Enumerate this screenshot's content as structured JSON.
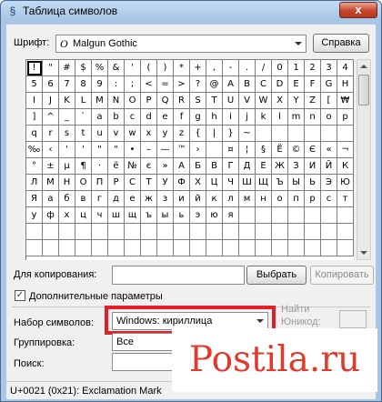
{
  "window": {
    "title": "Таблица символов",
    "close": "x"
  },
  "font": {
    "label": "Шрифт:",
    "icon": "O",
    "value": "Malgun Gothic",
    "help_button": "Справка"
  },
  "grid": {
    "rows": [
      [
        "!",
        "\"",
        "#",
        "$",
        "%",
        "&",
        "'",
        "(",
        ")",
        "*",
        "+",
        ",",
        "-",
        ".",
        "/",
        "0",
        "1",
        "2",
        "3",
        "4"
      ],
      [
        "5",
        "6",
        "7",
        "8",
        "9",
        ":",
        ";",
        "<",
        "=",
        ">",
        "?",
        "@",
        "A",
        "B",
        "C",
        "D",
        "E",
        "F",
        "G",
        "H"
      ],
      [
        "I",
        "J",
        "K",
        "L",
        "M",
        "N",
        "O",
        "P",
        "Q",
        "R",
        "S",
        "T",
        "U",
        "V",
        "W",
        "X",
        "Y",
        "Z",
        "[",
        "₩"
      ],
      [
        "]",
        "^",
        "_",
        "`",
        "a",
        "b",
        "c",
        "d",
        "e",
        "f",
        "g",
        "h",
        "i",
        "j",
        "k",
        "l",
        "m",
        "n",
        "o",
        "p"
      ],
      [
        "q",
        "r",
        "s",
        "t",
        "u",
        "v",
        "w",
        "x",
        "y",
        "z",
        "{",
        "|",
        "}",
        "~",
        "",
        "",
        "",
        "",
        "",
        ""
      ],
      [
        "‰",
        "‹",
        "'",
        "'",
        "\"",
        "\"",
        "•",
        "–",
        "—",
        "™",
        "›",
        "",
        "¤",
        "¦",
        "§",
        "Ё",
        "©",
        "Є",
        "«",
        "¬"
      ],
      [
        "°",
        "±",
        "µ",
        "¶",
        "·",
        "ё",
        "№",
        "є",
        "»",
        "А",
        "Б",
        "В",
        "Г",
        "Д",
        "Е",
        "Ж",
        "З",
        "И",
        "Й",
        "К"
      ],
      [
        "Л",
        "М",
        "Н",
        "О",
        "П",
        "Р",
        "С",
        "Т",
        "У",
        "Ф",
        "Х",
        "Ц",
        "Ч",
        "Ш",
        "Щ",
        "Ъ",
        "Ы",
        "Ь",
        "Э",
        "Ю"
      ],
      [
        "Я",
        "а",
        "б",
        "в",
        "г",
        "д",
        "е",
        "ж",
        "з",
        "и",
        "й",
        "к",
        "л",
        "м",
        "н",
        "о",
        "п",
        "р",
        "с",
        "т"
      ],
      [
        "у",
        "ф",
        "х",
        "ц",
        "ч",
        "ш",
        "щ",
        "ъ",
        "ы",
        "ь",
        "э",
        "ю",
        "я",
        "",
        "",
        "",
        "",
        "",
        "",
        ""
      ],
      [
        "",
        "",
        "",
        "",
        "",
        "",
        "",
        "",
        "",
        "",
        "",
        "",
        "",
        "",
        "",
        "",
        "",
        "",
        "",
        ""
      ],
      [
        "",
        "",
        "",
        "",
        "",
        "",
        "",
        "",
        "",
        "",
        "",
        "",
        "",
        "",
        "",
        "",
        "",
        "",
        "",
        ""
      ]
    ]
  },
  "copy": {
    "label": "Для копирования:",
    "value": "",
    "select_button": "Выбрать",
    "copy_button": "Копировать"
  },
  "advanced": {
    "label": "Дополнительные параметры",
    "checked_mark": "✓"
  },
  "charset": {
    "label": "Набор символов:",
    "value": "Windows: кириллица"
  },
  "grouping": {
    "label": "Группировка:",
    "value": "Все"
  },
  "goto_unicode": {
    "label_line1": "Найти",
    "label_line2": "Юникод:"
  },
  "search": {
    "label": "Поиск:",
    "value": ""
  },
  "status": {
    "text": "U+0021 (0x21): Exclamation Mark"
  },
  "watermark": {
    "text": "Postila.ru"
  },
  "colors": {
    "highlight": "#e11f25",
    "watermark": "#e03a2c",
    "title_bar": "#a9c6e6"
  }
}
